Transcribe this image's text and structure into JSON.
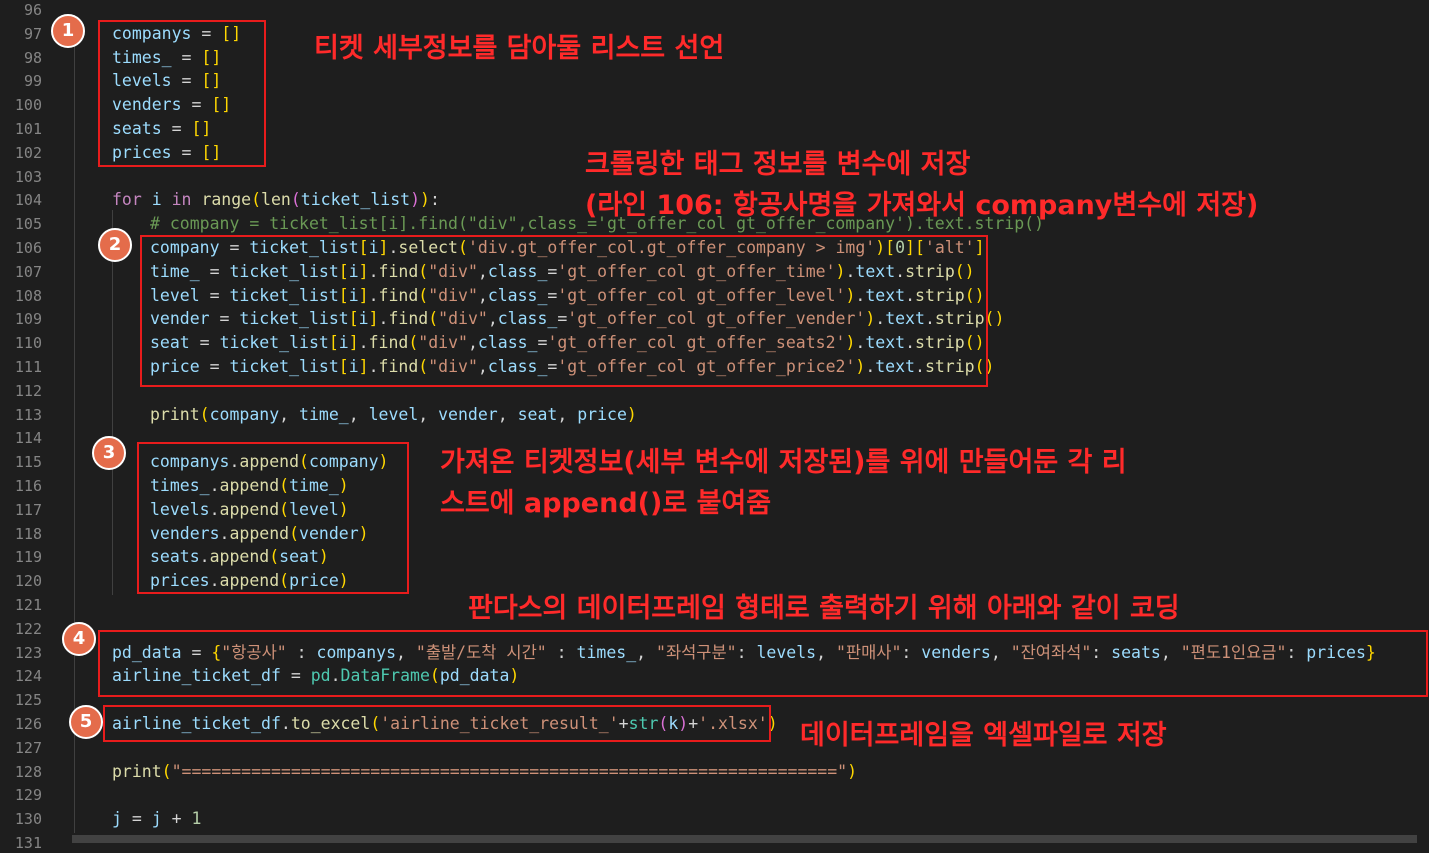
{
  "lines": [
    {
      "n": "96",
      "indent": 0,
      "tokens": []
    },
    {
      "n": "97",
      "indent": 0,
      "tokens": [
        [
          "var",
          "companys"
        ],
        [
          "p",
          " = "
        ],
        [
          "br1",
          "[]"
        ]
      ]
    },
    {
      "n": "98",
      "indent": 0,
      "tokens": [
        [
          "var",
          "times_"
        ],
        [
          "p",
          " = "
        ],
        [
          "br1",
          "[]"
        ]
      ]
    },
    {
      "n": "99",
      "indent": 0,
      "tokens": [
        [
          "var",
          "levels"
        ],
        [
          "p",
          " = "
        ],
        [
          "br1",
          "[]"
        ]
      ]
    },
    {
      "n": "100",
      "indent": 0,
      "tokens": [
        [
          "var",
          "venders"
        ],
        [
          "p",
          " = "
        ],
        [
          "br1",
          "[]"
        ]
      ]
    },
    {
      "n": "101",
      "indent": 0,
      "tokens": [
        [
          "var",
          "seats"
        ],
        [
          "p",
          " = "
        ],
        [
          "br1",
          "[]"
        ]
      ]
    },
    {
      "n": "102",
      "indent": 0,
      "tokens": [
        [
          "var",
          "prices"
        ],
        [
          "p",
          " = "
        ],
        [
          "br1",
          "[]"
        ]
      ]
    },
    {
      "n": "103",
      "indent": 0,
      "tokens": []
    },
    {
      "n": "104",
      "indent": 0,
      "tokens": [
        [
          "ctl",
          "for"
        ],
        [
          "p",
          " "
        ],
        [
          "var",
          "i"
        ],
        [
          "p",
          " "
        ],
        [
          "ctl",
          "in"
        ],
        [
          "p",
          " "
        ],
        [
          "fn",
          "range"
        ],
        [
          "br1",
          "("
        ],
        [
          "fn",
          "len"
        ],
        [
          "br2",
          "("
        ],
        [
          "var",
          "ticket_list"
        ],
        [
          "br2",
          ")"
        ],
        [
          "br1",
          ")"
        ],
        [
          "p",
          ":"
        ]
      ]
    },
    {
      "n": "105",
      "indent": 1,
      "tokens": [
        [
          "com",
          "# company = ticket_list[i].find(\"div\",class_='gt_offer_col gt_offer_company').text.strip()"
        ]
      ]
    },
    {
      "n": "106",
      "indent": 1,
      "tokens": [
        [
          "var",
          "company"
        ],
        [
          "p",
          " = "
        ],
        [
          "var",
          "ticket_list"
        ],
        [
          "br1",
          "["
        ],
        [
          "var",
          "i"
        ],
        [
          "br1",
          "]"
        ],
        [
          "p",
          "."
        ],
        [
          "fn",
          "select"
        ],
        [
          "br1",
          "("
        ],
        [
          "str",
          "'div.gt_offer_col.gt_offer_company > img'"
        ],
        [
          "br1",
          ")"
        ],
        [
          "br1",
          "["
        ],
        [
          "num",
          "0"
        ],
        [
          "br1",
          "]"
        ],
        [
          "br1",
          "["
        ],
        [
          "str",
          "'alt'"
        ],
        [
          "br1",
          "]"
        ]
      ]
    },
    {
      "n": "107",
      "indent": 1,
      "tokens": [
        [
          "var",
          "time_"
        ],
        [
          "p",
          " = "
        ],
        [
          "var",
          "ticket_list"
        ],
        [
          "br1",
          "["
        ],
        [
          "var",
          "i"
        ],
        [
          "br1",
          "]"
        ],
        [
          "p",
          "."
        ],
        [
          "fn",
          "find"
        ],
        [
          "br1",
          "("
        ],
        [
          "str",
          "\"div\""
        ],
        [
          "p",
          ","
        ],
        [
          "var",
          "class_"
        ],
        [
          "p",
          "="
        ],
        [
          "str",
          "'gt_offer_col gt_offer_time'"
        ],
        [
          "br1",
          ")"
        ],
        [
          "p",
          "."
        ],
        [
          "var",
          "text"
        ],
        [
          "p",
          "."
        ],
        [
          "fn",
          "strip"
        ],
        [
          "br1",
          "()"
        ]
      ]
    },
    {
      "n": "108",
      "indent": 1,
      "tokens": [
        [
          "var",
          "level"
        ],
        [
          "p",
          " = "
        ],
        [
          "var",
          "ticket_list"
        ],
        [
          "br1",
          "["
        ],
        [
          "var",
          "i"
        ],
        [
          "br1",
          "]"
        ],
        [
          "p",
          "."
        ],
        [
          "fn",
          "find"
        ],
        [
          "br1",
          "("
        ],
        [
          "str",
          "\"div\""
        ],
        [
          "p",
          ","
        ],
        [
          "var",
          "class_"
        ],
        [
          "p",
          "="
        ],
        [
          "str",
          "'gt_offer_col gt_offer_level'"
        ],
        [
          "br1",
          ")"
        ],
        [
          "p",
          "."
        ],
        [
          "var",
          "text"
        ],
        [
          "p",
          "."
        ],
        [
          "fn",
          "strip"
        ],
        [
          "br1",
          "()"
        ]
      ]
    },
    {
      "n": "109",
      "indent": 1,
      "tokens": [
        [
          "var",
          "vender"
        ],
        [
          "p",
          " = "
        ],
        [
          "var",
          "ticket_list"
        ],
        [
          "br1",
          "["
        ],
        [
          "var",
          "i"
        ],
        [
          "br1",
          "]"
        ],
        [
          "p",
          "."
        ],
        [
          "fn",
          "find"
        ],
        [
          "br1",
          "("
        ],
        [
          "str",
          "\"div\""
        ],
        [
          "p",
          ","
        ],
        [
          "var",
          "class_"
        ],
        [
          "p",
          "="
        ],
        [
          "str",
          "'gt_offer_col gt_offer_vender'"
        ],
        [
          "br1",
          ")"
        ],
        [
          "p",
          "."
        ],
        [
          "var",
          "text"
        ],
        [
          "p",
          "."
        ],
        [
          "fn",
          "strip"
        ],
        [
          "br1",
          "()"
        ]
      ]
    },
    {
      "n": "110",
      "indent": 1,
      "tokens": [
        [
          "var",
          "seat"
        ],
        [
          "p",
          " = "
        ],
        [
          "var",
          "ticket_list"
        ],
        [
          "br1",
          "["
        ],
        [
          "var",
          "i"
        ],
        [
          "br1",
          "]"
        ],
        [
          "p",
          "."
        ],
        [
          "fn",
          "find"
        ],
        [
          "br1",
          "("
        ],
        [
          "str",
          "\"div\""
        ],
        [
          "p",
          ","
        ],
        [
          "var",
          "class_"
        ],
        [
          "p",
          "="
        ],
        [
          "str",
          "'gt_offer_col gt_offer_seats2'"
        ],
        [
          "br1",
          ")"
        ],
        [
          "p",
          "."
        ],
        [
          "var",
          "text"
        ],
        [
          "p",
          "."
        ],
        [
          "fn",
          "strip"
        ],
        [
          "br1",
          "()"
        ]
      ]
    },
    {
      "n": "111",
      "indent": 1,
      "tokens": [
        [
          "var",
          "price"
        ],
        [
          "p",
          " = "
        ],
        [
          "var",
          "ticket_list"
        ],
        [
          "br1",
          "["
        ],
        [
          "var",
          "i"
        ],
        [
          "br1",
          "]"
        ],
        [
          "p",
          "."
        ],
        [
          "fn",
          "find"
        ],
        [
          "br1",
          "("
        ],
        [
          "str",
          "\"div\""
        ],
        [
          "p",
          ","
        ],
        [
          "var",
          "class_"
        ],
        [
          "p",
          "="
        ],
        [
          "str",
          "'gt_offer_col gt_offer_price2'"
        ],
        [
          "br1",
          ")"
        ],
        [
          "p",
          "."
        ],
        [
          "var",
          "text"
        ],
        [
          "p",
          "."
        ],
        [
          "fn",
          "strip"
        ],
        [
          "br1",
          "()"
        ]
      ]
    },
    {
      "n": "112",
      "indent": 1,
      "tokens": []
    },
    {
      "n": "113",
      "indent": 1,
      "tokens": [
        [
          "fn",
          "print"
        ],
        [
          "br1",
          "("
        ],
        [
          "var",
          "company"
        ],
        [
          "p",
          ", "
        ],
        [
          "var",
          "time_"
        ],
        [
          "p",
          ", "
        ],
        [
          "var",
          "level"
        ],
        [
          "p",
          ", "
        ],
        [
          "var",
          "vender"
        ],
        [
          "p",
          ", "
        ],
        [
          "var",
          "seat"
        ],
        [
          "p",
          ", "
        ],
        [
          "var",
          "price"
        ],
        [
          "br1",
          ")"
        ]
      ]
    },
    {
      "n": "114",
      "indent": 1,
      "tokens": []
    },
    {
      "n": "115",
      "indent": 1,
      "tokens": [
        [
          "var",
          "companys"
        ],
        [
          "p",
          "."
        ],
        [
          "fn",
          "append"
        ],
        [
          "br1",
          "("
        ],
        [
          "var",
          "company"
        ],
        [
          "br1",
          ")"
        ]
      ]
    },
    {
      "n": "116",
      "indent": 1,
      "tokens": [
        [
          "var",
          "times_"
        ],
        [
          "p",
          "."
        ],
        [
          "fn",
          "append"
        ],
        [
          "br1",
          "("
        ],
        [
          "var",
          "time_"
        ],
        [
          "br1",
          ")"
        ]
      ]
    },
    {
      "n": "117",
      "indent": 1,
      "tokens": [
        [
          "var",
          "levels"
        ],
        [
          "p",
          "."
        ],
        [
          "fn",
          "append"
        ],
        [
          "br1",
          "("
        ],
        [
          "var",
          "level"
        ],
        [
          "br1",
          ")"
        ]
      ]
    },
    {
      "n": "118",
      "indent": 1,
      "tokens": [
        [
          "var",
          "venders"
        ],
        [
          "p",
          "."
        ],
        [
          "fn",
          "append"
        ],
        [
          "br1",
          "("
        ],
        [
          "var",
          "vender"
        ],
        [
          "br1",
          ")"
        ]
      ]
    },
    {
      "n": "119",
      "indent": 1,
      "tokens": [
        [
          "var",
          "seats"
        ],
        [
          "p",
          "."
        ],
        [
          "fn",
          "append"
        ],
        [
          "br1",
          "("
        ],
        [
          "var",
          "seat"
        ],
        [
          "br1",
          ")"
        ]
      ]
    },
    {
      "n": "120",
      "indent": 1,
      "tokens": [
        [
          "var",
          "prices"
        ],
        [
          "p",
          "."
        ],
        [
          "fn",
          "append"
        ],
        [
          "br1",
          "("
        ],
        [
          "var",
          "price"
        ],
        [
          "br1",
          ")"
        ]
      ]
    },
    {
      "n": "121",
      "indent": 0,
      "tokens": []
    },
    {
      "n": "122",
      "indent": 0,
      "tokens": []
    },
    {
      "n": "123",
      "indent": 0,
      "tokens": [
        [
          "var",
          "pd_data"
        ],
        [
          "p",
          " = "
        ],
        [
          "br1",
          "{"
        ],
        [
          "str",
          "\"항공사\""
        ],
        [
          "p",
          " : "
        ],
        [
          "var",
          "companys"
        ],
        [
          "p",
          ", "
        ],
        [
          "str",
          "\"출발/도착 시간\""
        ],
        [
          "p",
          " : "
        ],
        [
          "var",
          "times_"
        ],
        [
          "p",
          ", "
        ],
        [
          "str",
          "\"좌석구분\""
        ],
        [
          "p",
          ": "
        ],
        [
          "var",
          "levels"
        ],
        [
          "p",
          ", "
        ],
        [
          "str",
          "\"판매사\""
        ],
        [
          "p",
          ": "
        ],
        [
          "var",
          "venders"
        ],
        [
          "p",
          ", "
        ],
        [
          "str",
          "\"잔여좌석\""
        ],
        [
          "p",
          ": "
        ],
        [
          "var",
          "seats"
        ],
        [
          "p",
          ", "
        ],
        [
          "str",
          "\"편도1인요금\""
        ],
        [
          "p",
          ": "
        ],
        [
          "var",
          "prices"
        ],
        [
          "br1",
          "}"
        ]
      ]
    },
    {
      "n": "124",
      "indent": 0,
      "tokens": [
        [
          "var",
          "airline_ticket_df"
        ],
        [
          "p",
          " = "
        ],
        [
          "cls",
          "pd"
        ],
        [
          "p",
          "."
        ],
        [
          "cls",
          "DataFrame"
        ],
        [
          "br1",
          "("
        ],
        [
          "var",
          "pd_data"
        ],
        [
          "br1",
          ")"
        ]
      ]
    },
    {
      "n": "125",
      "indent": 0,
      "tokens": []
    },
    {
      "n": "126",
      "indent": 0,
      "tokens": [
        [
          "var",
          "airline_ticket_df"
        ],
        [
          "p",
          "."
        ],
        [
          "fn",
          "to_excel"
        ],
        [
          "br1",
          "("
        ],
        [
          "str",
          "'airline_ticket_result_'"
        ],
        [
          "p",
          "+"
        ],
        [
          "cls",
          "str"
        ],
        [
          "br2",
          "("
        ],
        [
          "var",
          "k"
        ],
        [
          "br2",
          ")"
        ],
        [
          "p",
          "+"
        ],
        [
          "str",
          "'.xlsx'"
        ],
        [
          "br1",
          ")"
        ]
      ]
    },
    {
      "n": "127",
      "indent": 0,
      "tokens": []
    },
    {
      "n": "128",
      "indent": 0,
      "tokens": [
        [
          "fn",
          "print"
        ],
        [
          "br1",
          "("
        ],
        [
          "str",
          "\"==================================================================\""
        ],
        [
          "br1",
          ")"
        ]
      ]
    },
    {
      "n": "129",
      "indent": 0,
      "tokens": []
    },
    {
      "n": "130",
      "indent": 0,
      "tokens": [
        [
          "var",
          "j"
        ],
        [
          "p",
          " = "
        ],
        [
          "var",
          "j"
        ],
        [
          "p",
          " + "
        ],
        [
          "num",
          "1"
        ]
      ]
    },
    {
      "n": "131",
      "indent": 0,
      "tokens": []
    }
  ],
  "annotations": {
    "badges": [
      "1",
      "2",
      "3",
      "4",
      "5"
    ],
    "note1": "티켓 세부정보를 담아둘 리스트 선언",
    "note2_line1": "크롤링한 태그 정보를 변수에 저장",
    "note2_line2": "(라인 106: 항공사명을 가져와서 company변수에 저장)",
    "note3_line1": "가져온 티켓정보(세부 변수에 저장된)를 위에 만들어둔 각 리",
    "note3_line2": "스트에 append()로 붙여줌",
    "note4": "판다스의 데이터프레임 형태로 출력하기 위해 아래와 같이 코딩",
    "note5": "데이터프레임을 엑셀파일로 저장"
  },
  "colors": {
    "background": "#1e1e1e",
    "annotation_red": "#e81c1c",
    "annotation_text": "#ff2a2a",
    "badge_fill": "#e46c4b"
  }
}
